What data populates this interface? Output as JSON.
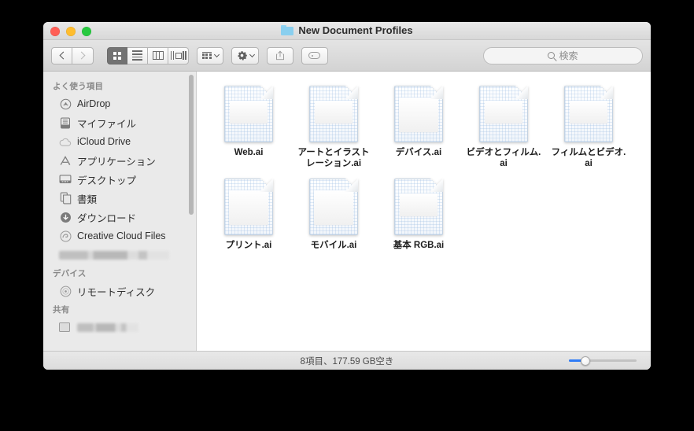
{
  "window": {
    "title": "New Document Profiles",
    "folder_icon": "folder-icon",
    "traffic_lights": [
      {
        "name": "close-button",
        "color": "#ff5f56"
      },
      {
        "name": "minimize-button",
        "color": "#ffbd2e"
      },
      {
        "name": "maximize-button",
        "color": "#27c93f"
      }
    ]
  },
  "toolbar": {
    "back_label": "‹",
    "forward_label": "›",
    "view_modes": [
      {
        "name": "icon-view",
        "icon": "grid-icon",
        "active": true
      },
      {
        "name": "list-view",
        "icon": "list-icon",
        "active": false
      },
      {
        "name": "column-view",
        "icon": "columns-icon",
        "active": false
      },
      {
        "name": "coverflow-view",
        "icon": "coverflow-icon",
        "active": false
      }
    ],
    "arrange_icon": "arrange-icon",
    "action_icon": "gear-icon",
    "share_icon": "share-icon",
    "tag_icon": "tag-icon"
  },
  "search": {
    "placeholder": "検索",
    "value": "",
    "icon": "search-icon"
  },
  "sidebar": {
    "sections": [
      {
        "header": "よく使う項目",
        "items": [
          {
            "label": "AirDrop",
            "icon": "airdrop-icon"
          },
          {
            "label": "マイファイル",
            "icon": "myfiles-icon"
          },
          {
            "label": "iCloud Drive",
            "icon": "icloud-icon"
          },
          {
            "label": "アプリケーション",
            "icon": "applications-icon"
          },
          {
            "label": "デスクトップ",
            "icon": "desktop-icon"
          },
          {
            "label": "書類",
            "icon": "documents-icon"
          },
          {
            "label": "ダウンロード",
            "icon": "downloads-icon"
          },
          {
            "label": "Creative Cloud Files",
            "icon": "creative-cloud-icon"
          },
          {
            "label": "",
            "icon": "",
            "redacted": true
          }
        ]
      },
      {
        "header": "デバイス",
        "items": [
          {
            "label": "リモートディスク",
            "icon": "remote-disc-icon"
          }
        ]
      },
      {
        "header": "共有",
        "items": [
          {
            "label": "",
            "icon": "shared-computer-icon",
            "redacted": true
          }
        ]
      }
    ]
  },
  "files": [
    {
      "name": "Web.ai",
      "icon": "ai-document-icon",
      "tall": false
    },
    {
      "name": "アートとイラストレーション.ai",
      "icon": "ai-document-icon",
      "tall": false
    },
    {
      "name": "デバイス.ai",
      "icon": "ai-document-icon",
      "tall": true
    },
    {
      "name": "ビデオとフィルム.ai",
      "icon": "ai-document-icon",
      "tall": false
    },
    {
      "name": "フィルムとビデオ.ai",
      "icon": "ai-document-icon",
      "tall": false
    },
    {
      "name": "プリント.ai",
      "icon": "ai-document-icon",
      "tall": true
    },
    {
      "name": "モバイル.ai",
      "icon": "ai-document-icon",
      "tall": true
    },
    {
      "name": "基本 RGB.ai",
      "icon": "ai-document-icon",
      "tall": false
    }
  ],
  "status": {
    "text": "8項目、177.59 GB空き",
    "zoom_slider": {
      "value": 22
    }
  },
  "colors": {
    "accent": "#2f7cf6",
    "window_chrome": "#e4e4e4",
    "sidebar": "#eaeaea",
    "content": "#ffffff",
    "folder": "#89cfef"
  }
}
